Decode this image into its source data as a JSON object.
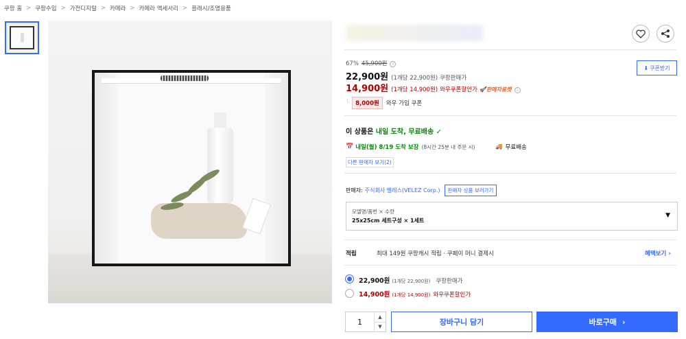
{
  "breadcrumb": [
    "쿠팡 홈",
    "쿠팡수입",
    "가전디지털",
    "카메라",
    "카메라 액세서리",
    "플래시/조명용품"
  ],
  "breadcrumb_sep": ">",
  "product": {
    "discount_rate": "67%",
    "original_price": "45,900원",
    "price": "22,900원",
    "unit_price": "(1개당 22,900원)",
    "price_label": "쿠팡판매가",
    "wow_price": "14,900원",
    "wow_unit_price": "(1개당 14,900원)",
    "wow_label": "와우쿠폰할인가",
    "rocket_label": "판매자로켓",
    "coupon_button": "쿠폰받기",
    "coupon_amount": "8,000원",
    "coupon_label": "와우 가입 쿠폰"
  },
  "delivery": {
    "headline_prefix": "이 상품은",
    "headline_emph": "내일 도착, 무료배송",
    "arrival": "내일(월) 8/19 도착 보장",
    "arrival_note": "(8시간 25분 내 주문 시)",
    "free_shipping": "무료배송",
    "other_sellers": "다른 판매자 보기(2)"
  },
  "seller": {
    "label": "판매자:",
    "name": "주식회사 벨레스(VELEZ Corp.)",
    "more_button": "판매자 상품 보러가기"
  },
  "option": {
    "label": "모델명/품번 × 수량",
    "value": "25x25cm 세트구성 × 1세트"
  },
  "rewards": {
    "label": "적립",
    "text": "최대 149원 쿠팡캐시 적립 · 쿠페이 머니 결제시",
    "link": "혜택보기"
  },
  "price_options": [
    {
      "price": "22,900원",
      "unit": "(1개당 22,900원)",
      "label": "쿠팡판매가",
      "selected": true
    },
    {
      "price": "14,900원",
      "unit": "(1개당 14,900원)",
      "label": "와우쿠폰할인가",
      "selected": false
    }
  ],
  "purchase": {
    "quantity": "1",
    "cart_button": "장바구니 담기",
    "buy_button": "바로구매"
  },
  "colors": {
    "accent": "#346aff",
    "price_red": "#ae0000",
    "rocket_orange": "#f05a1e",
    "delivery_green": "#008c00"
  }
}
